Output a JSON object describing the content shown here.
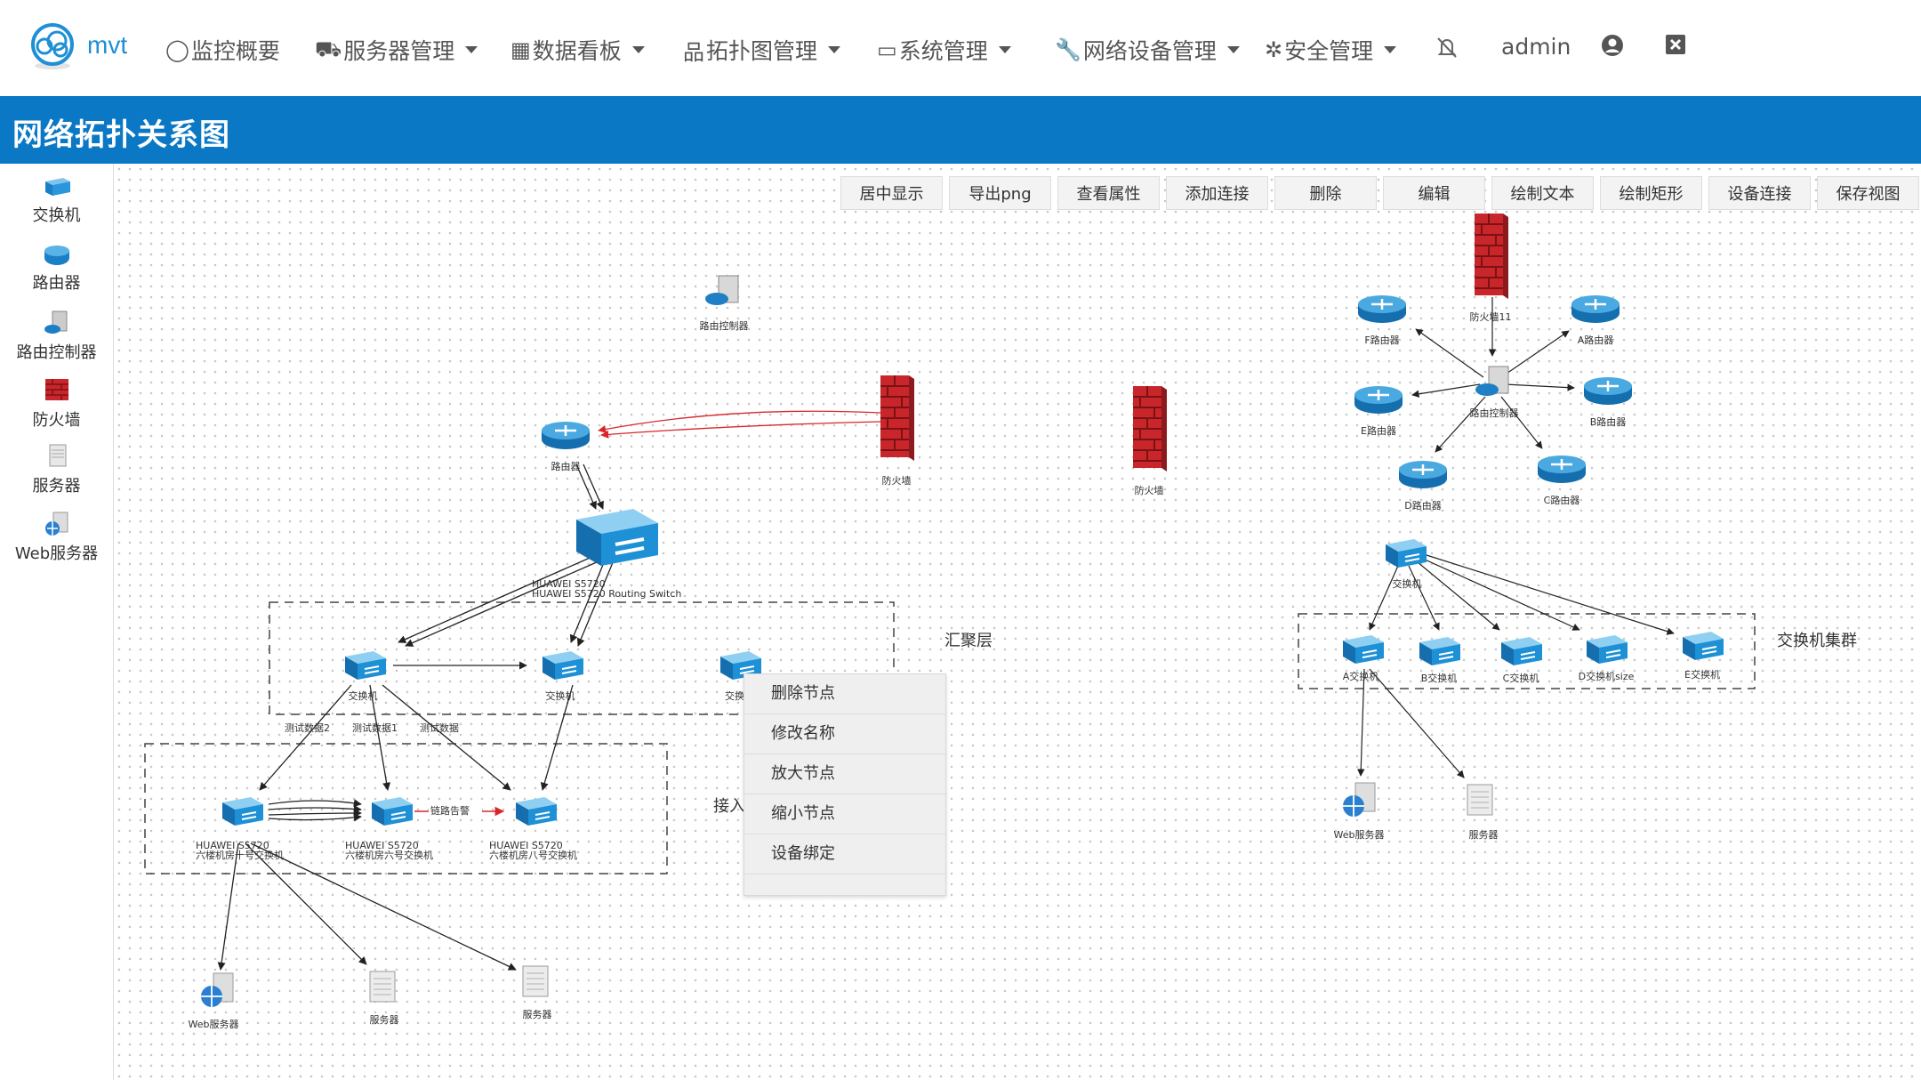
{
  "nav": {
    "brand": "mvt",
    "items": [
      {
        "label": "监控概要",
        "icon": "circle-icon",
        "caret": false
      },
      {
        "label": "服务器管理",
        "icon": "car-icon",
        "caret": true
      },
      {
        "label": "数据看板",
        "icon": "grid-icon",
        "caret": true
      },
      {
        "label": "拓扑图管理",
        "icon": "sitemap-icon",
        "caret": true
      },
      {
        "label": "系统管理",
        "icon": "monitor-icon",
        "caret": true
      },
      {
        "label": "网络设备管理",
        "icon": "wrench-icon",
        "caret": true
      },
      {
        "label": "安全管理",
        "icon": "bug-icon",
        "caret": true
      }
    ],
    "user": "admin"
  },
  "page_title": "网络拓扑关系图",
  "sidebar": {
    "items": [
      {
        "label": "交换机",
        "icon": "switch-icon"
      },
      {
        "label": "路由器",
        "icon": "router-icon"
      },
      {
        "label": "路由控制器",
        "icon": "route-controller-icon"
      },
      {
        "label": "防火墙",
        "icon": "firewall-icon"
      },
      {
        "label": "服务器",
        "icon": "server-icon"
      },
      {
        "label": "Web服务器",
        "icon": "web-server-icon"
      }
    ]
  },
  "toolbar": [
    "居中显示",
    "导出png",
    "查看属性",
    "添加连接",
    "删除",
    "编辑",
    "绘制文本",
    "绘制矩形",
    "设备连接",
    "保存视图"
  ],
  "topology": {
    "groups": {
      "aggregation": "汇聚层",
      "access": "接入",
      "switch_cluster": "交换机集群"
    },
    "nodes": {
      "route_controller_top": "路由控制器",
      "router_main": "路由器",
      "firewall_main": "防火墙",
      "firewall_mid": "防火墙",
      "core_switch_l1": "HUAWEI S5720",
      "core_switch_l2": "HUAWEI S5720 Routing Switch",
      "agg_switch_1": "交换机",
      "agg_switch_2": "交换机",
      "agg_switch_3": "交换",
      "acc_1_l1": "HUAWEI S5720",
      "acc_1_l2": "六楼机房十号交换机",
      "acc_2_l1": "HUAWEI S5720",
      "acc_2_l2": "六楼机房六号交换机",
      "acc_3_l1": "HUAWEI S5720",
      "acc_3_l2": "六楼机房八号交换机",
      "web_server_left": "Web服务器",
      "server_left_1": "服务器",
      "server_left_2": "服务器",
      "firewall_r": "防火墙11",
      "rc_r": "路由控制器",
      "router_f": "F路由器",
      "router_a": "A路由器",
      "router_e": "E路由器",
      "router_b": "B路由器",
      "router_d": "D路由器",
      "router_c": "C路由器",
      "switch_r": "交换机",
      "sw_a": "A交换机",
      "sw_b": "B交换机",
      "sw_c": "C交换机",
      "sw_d": "D交换机size",
      "sw_e": "E交换机",
      "web_server_r": "Web服务器",
      "server_r": "服务器"
    },
    "links": {
      "test1": "测试数据2",
      "test2": "测试数据1",
      "test3": "测试数据",
      "alarm": "链路告警"
    }
  },
  "context_menu": [
    "删除节点",
    "修改名称",
    "放大节点",
    "缩小节点",
    "设备绑定"
  ],
  "colors": {
    "primary": "#0b78c5",
    "switch": "#1e90d6",
    "firewall": "#c8262b",
    "alarm_link": "#d9262b"
  }
}
